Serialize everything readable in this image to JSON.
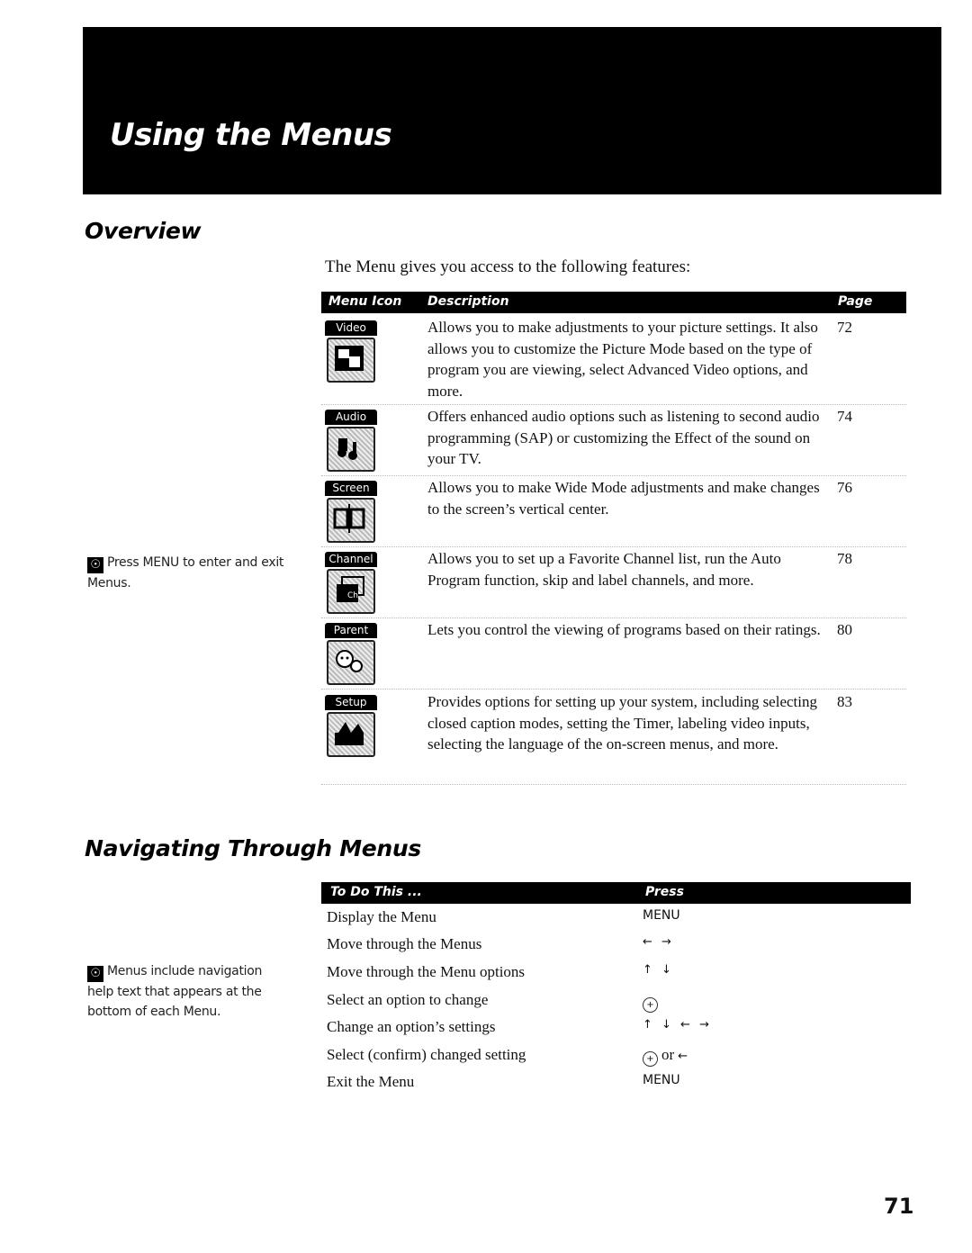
{
  "header": {
    "title": "Using the Menus"
  },
  "overview": {
    "title": "Overview",
    "intro": "The Menu gives you access to the following features:",
    "columns": {
      "icon": "Menu Icon",
      "description": "Description",
      "page": "Page"
    },
    "rows": [
      {
        "icon_label": "Video",
        "icon": "video-menu-icon",
        "description": "Allows you to make adjustments to your picture settings. It also allows you to customize the Picture Mode based on the type of program you are viewing, select Advanced Video options, and more.",
        "page": "72"
      },
      {
        "icon_label": "Audio",
        "icon": "audio-menu-icon",
        "description": "Offers enhanced audio options such as listening to second audio programming (SAP) or customizing the Effect of the sound on your TV.",
        "page": "74"
      },
      {
        "icon_label": "Screen",
        "icon": "screen-menu-icon",
        "description": "Allows you to make Wide Mode adjustments and make changes to the screen’s vertical center.",
        "page": "76"
      },
      {
        "icon_label": "Channel",
        "icon": "channel-menu-icon",
        "description": "Allows you to set up a Favorite Channel list, run the Auto Program function, skip and label channels, and more.",
        "page": "78"
      },
      {
        "icon_label": "Parent",
        "icon": "parent-menu-icon",
        "description": "Lets you control the viewing of programs based on their ratings.",
        "page": "80"
      },
      {
        "icon_label": "Setup",
        "icon": "setup-menu-icon",
        "description": "Provides options for  setting up your system, including selecting closed caption modes, setting the Timer, labeling video inputs, selecting the language of the on-screen menus, and more.",
        "page": "83"
      }
    ],
    "tip": "Press MENU to enter and exit Menus."
  },
  "navigating": {
    "title": "Navigating Through Menus",
    "columns": {
      "action": "To Do This ...",
      "press": "Press"
    },
    "rows": [
      {
        "action": "Display the Menu",
        "press": "MENU"
      },
      {
        "action": "Move through the Menus",
        "press": "← →"
      },
      {
        "action": "Move through the Menu options",
        "press": "↑ ↓"
      },
      {
        "action": "Select an option to change",
        "press": "⊕"
      },
      {
        "action": "Change an option’s settings",
        "press": "↑ ↓ ← →"
      },
      {
        "action": "Select (confirm) changed setting",
        "press": "⊕",
        "press_or": "or",
        "press_alt": "←"
      },
      {
        "action": "Exit the Menu",
        "press": "MENU"
      }
    ],
    "tip": "Menus include navigation help text that appears at the bottom of each Menu."
  },
  "tip_icon": "lightbulb-icon",
  "page_number": "71"
}
